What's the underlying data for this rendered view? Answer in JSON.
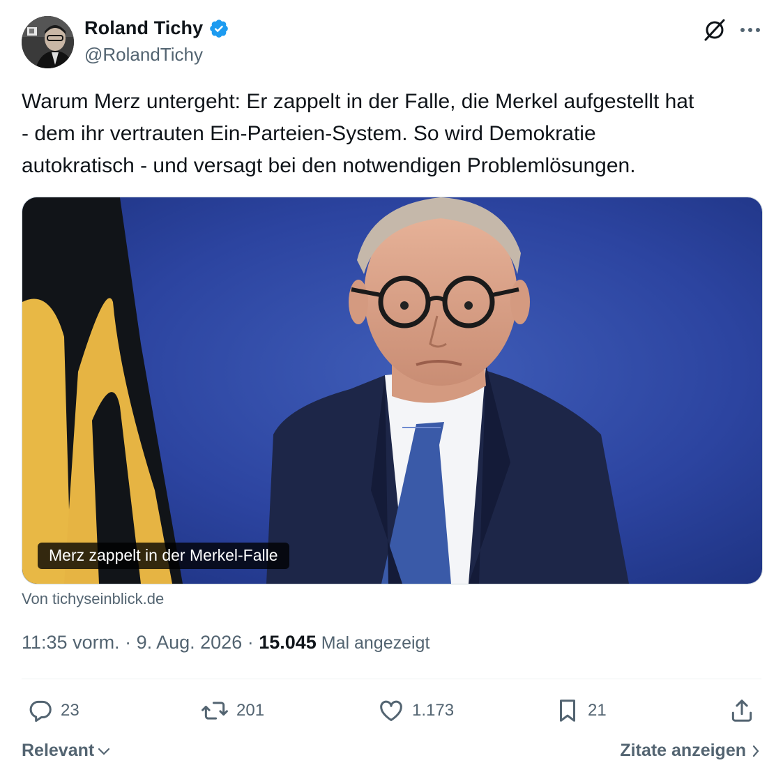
{
  "author": {
    "display_name": "Roland Tichy",
    "handle": "@RolandTichy",
    "verified": true,
    "verified_color": "#1d9bf0"
  },
  "tweet": {
    "text": "Warum Merz untergeht: Er zappelt in der Falle, die Merkel aufgestellt hat\n- dem ihr vertrauten Ein-Parteien-System. So wird Demokratie\nautokratisch - und versagt bei den notwendigen Problemlösungen."
  },
  "card": {
    "caption": "Merz zappelt in der Merkel-Falle",
    "source": "Von tichyseinblick.de"
  },
  "meta": {
    "time": "11:35 vorm.",
    "separator": " · ",
    "date": "9. Aug. 2026",
    "views_count": "15.045",
    "views_label": " Mal angezeigt"
  },
  "actions": {
    "replies": "23",
    "reposts": "201",
    "likes": "1.173",
    "bookmarks": "21"
  },
  "footer": {
    "sort_label": "Relevant",
    "quotes_label": "Zitate anzeigen"
  },
  "icons": {
    "header": [
      "grok-icon",
      "more-icon"
    ],
    "actions": [
      "reply-icon",
      "repost-icon",
      "like-icon",
      "bookmark-icon",
      "share-icon"
    ]
  },
  "colors": {
    "text_primary": "#0f1419",
    "text_secondary": "#536471",
    "background": "#ffffff",
    "divider": "#eff3f4"
  }
}
